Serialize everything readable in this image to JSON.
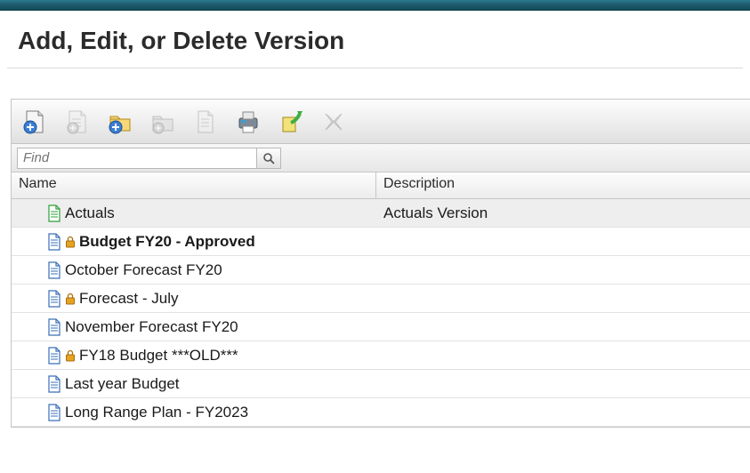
{
  "page": {
    "title": "Add, Edit, or Delete Version"
  },
  "toolbar": {
    "buttons": [
      {
        "name": "new-sheet-button"
      },
      {
        "name": "copy-sheet-button"
      },
      {
        "name": "new-folder-button"
      },
      {
        "name": "folder-button"
      },
      {
        "name": "document-button"
      },
      {
        "name": "print-button"
      },
      {
        "name": "export-button"
      },
      {
        "name": "delete-button"
      }
    ]
  },
  "find": {
    "placeholder": "Find"
  },
  "grid": {
    "headers": {
      "name": "Name",
      "description": "Description"
    },
    "rows": [
      {
        "name": "Actuals",
        "description": "Actuals Version",
        "locked": false,
        "bold": false,
        "selected": true,
        "iconColor": "green"
      },
      {
        "name": "Budget FY20 - Approved",
        "description": "",
        "locked": true,
        "bold": true,
        "selected": false,
        "iconColor": "blue"
      },
      {
        "name": "October Forecast FY20",
        "description": "",
        "locked": false,
        "bold": false,
        "selected": false,
        "iconColor": "blue"
      },
      {
        "name": "Forecast - July",
        "description": "",
        "locked": true,
        "bold": false,
        "selected": false,
        "iconColor": "blue"
      },
      {
        "name": "November Forecast FY20",
        "description": "",
        "locked": false,
        "bold": false,
        "selected": false,
        "iconColor": "blue"
      },
      {
        "name": "FY18 Budget ***OLD***",
        "description": "",
        "locked": true,
        "bold": false,
        "selected": false,
        "iconColor": "blue"
      },
      {
        "name": "Last year Budget",
        "description": "",
        "locked": false,
        "bold": false,
        "selected": false,
        "iconColor": "blue"
      },
      {
        "name": "Long Range Plan - FY2023",
        "description": "",
        "locked": false,
        "bold": false,
        "selected": false,
        "iconColor": "blue"
      }
    ]
  }
}
